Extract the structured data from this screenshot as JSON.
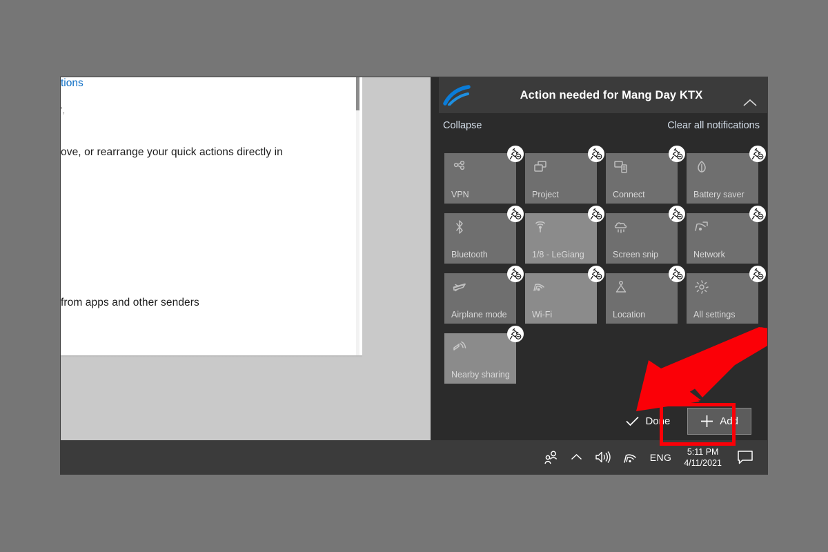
{
  "background_color": "#767676",
  "settings_window": {
    "partial_text_top": "',",
    "body_line_1": "ove, or rearrange your quick actions directly in",
    "link_text": "tions",
    "body_line_2": "from apps and other senders",
    "scrollbar": "vertical-scrollbar"
  },
  "action_center": {
    "notification": {
      "title": "Action needed for Mang Day KTX",
      "icon": "onedrive-swoosh-icon",
      "collapse_chevron": "chevron-up-icon"
    },
    "links": {
      "collapse": "Collapse",
      "clear_all": "Clear all notifications"
    },
    "quick_actions": [
      {
        "label": "VPN",
        "icon": "vpn-icon",
        "state": "normal",
        "badge": "unpin-icon"
      },
      {
        "label": "Project",
        "icon": "project-icon",
        "state": "normal",
        "badge": "unpin-icon"
      },
      {
        "label": "Connect",
        "icon": "connect-icon",
        "state": "normal",
        "badge": "unpin-icon"
      },
      {
        "label": "Battery saver",
        "icon": "battery-saver-icon",
        "state": "normal",
        "badge": "unpin-icon"
      },
      {
        "label": "Bluetooth",
        "icon": "bluetooth-icon",
        "state": "normal",
        "badge": "unpin-icon"
      },
      {
        "label": "1/8 - LeGiang",
        "icon": "mobile-hotspot-icon",
        "state": "lighter",
        "badge": "unpin-icon"
      },
      {
        "label": "Screen snip",
        "icon": "screen-snip-icon",
        "state": "normal",
        "badge": "unpin-icon"
      },
      {
        "label": "Network",
        "icon": "network-icon",
        "state": "normal",
        "badge": "unpin-icon"
      },
      {
        "label": "Airplane mode",
        "icon": "airplane-icon",
        "state": "normal",
        "badge": "unpin-icon"
      },
      {
        "label": "Wi-Fi",
        "icon": "wifi-icon",
        "state": "lighter",
        "badge": "unpin-icon"
      },
      {
        "label": "Location",
        "icon": "location-icon",
        "state": "normal",
        "badge": "unpin-icon"
      },
      {
        "label": "All settings",
        "icon": "gear-icon",
        "state": "normal",
        "badge": "unpin-icon"
      },
      {
        "label": "Nearby sharing",
        "icon": "nearby-sharing-icon",
        "state": "lighter",
        "badge": "unpin-icon"
      }
    ],
    "buttons": {
      "done": "Done",
      "done_icon": "check-icon",
      "add": "Add",
      "add_icon": "plus-icon"
    }
  },
  "annotation": {
    "highlight_color": "#fb0007",
    "arrow": "red-arrow-pointing-to-add-button",
    "highlight_target": "Add"
  },
  "taskbar": {
    "people_icon": "people-icon",
    "show_hidden_icon": "chevron-up-icon",
    "volume_icon": "speaker-icon",
    "wifi_icon": "wifi-icon",
    "language": "ENG",
    "time": "5:11 PM",
    "date": "4/11/2021",
    "action_center_icon": "notification-balloon-icon"
  }
}
